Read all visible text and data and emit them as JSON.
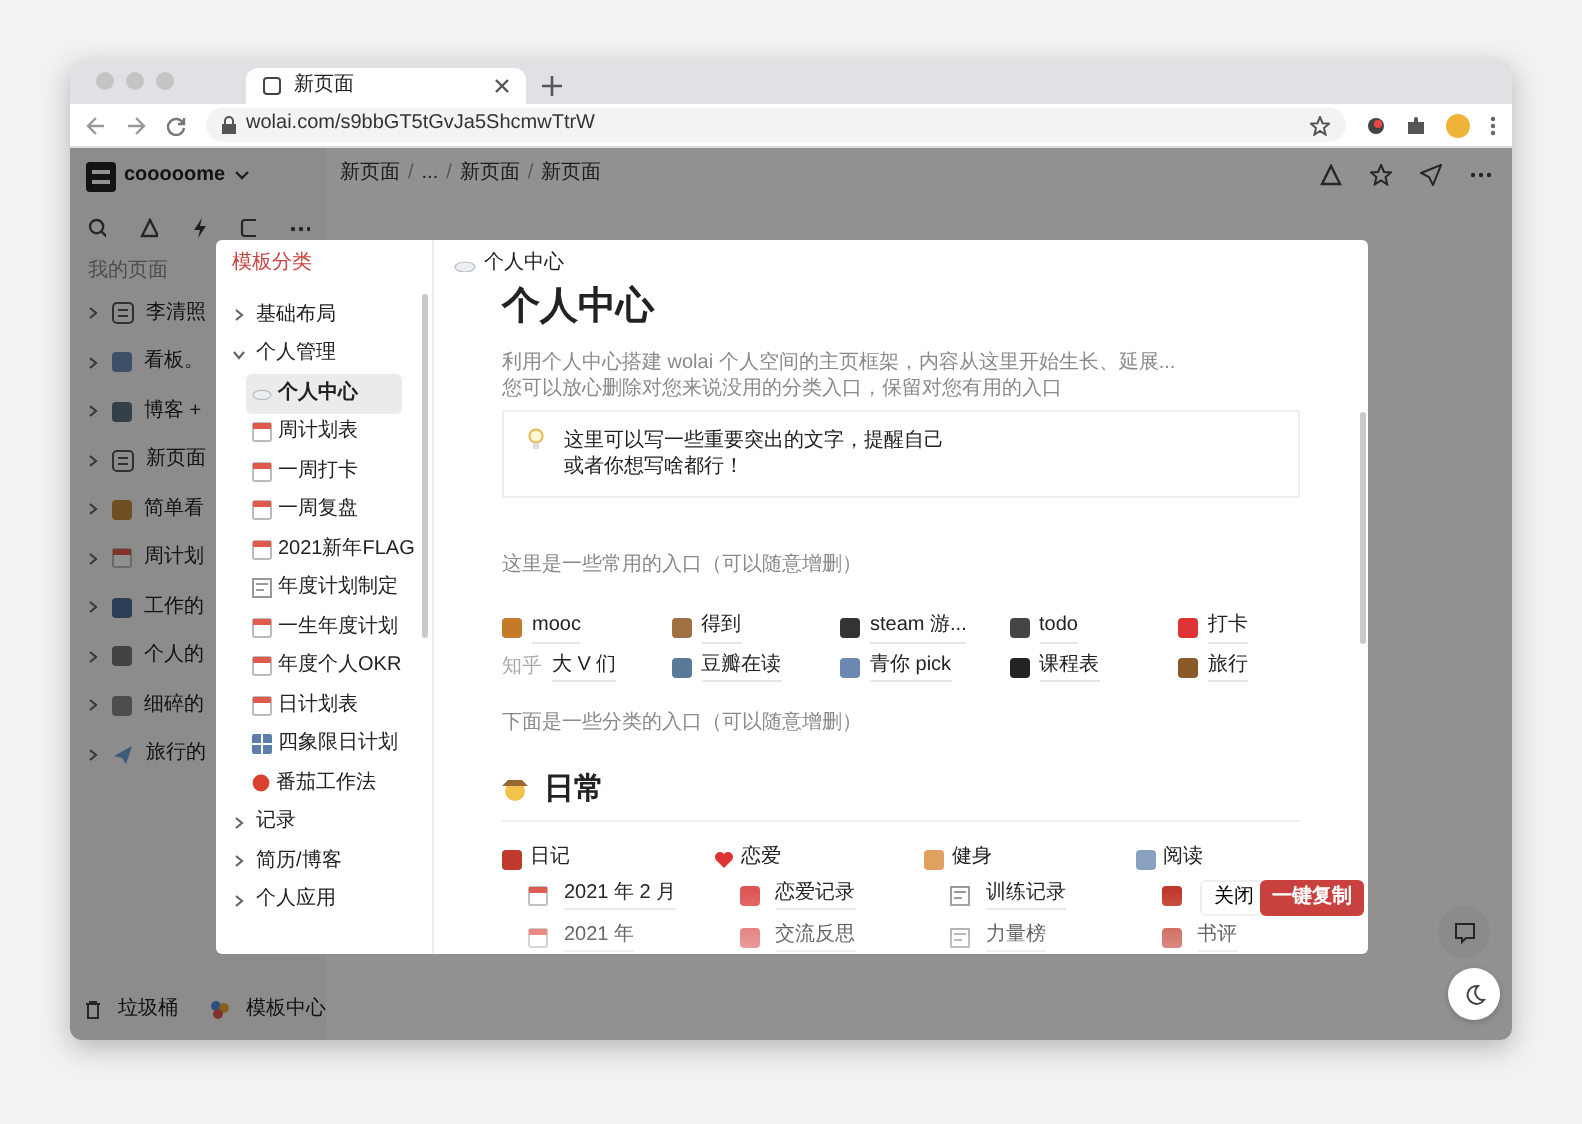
{
  "browser": {
    "tab_title": "新页面",
    "url": "wolai.com/s9bbGT5tGvJa5ShcmwTtrW"
  },
  "workspace": {
    "name": "cooooome"
  },
  "sidebar": {
    "section": "我的页面",
    "items": [
      "李清照",
      "看板。",
      "博客 +",
      "新页面",
      "简单看",
      "周计划",
      "工作的",
      "个人的",
      "细碎的",
      "旅行的"
    ],
    "footer": [
      "垃圾桶",
      "模板中心"
    ]
  },
  "breadcrumb": [
    {
      "kind": "item",
      "text": "新页面"
    },
    {
      "kind": "separator",
      "text": "/"
    },
    {
      "kind": "item",
      "text": "..."
    },
    {
      "kind": "separator",
      "text": "/"
    },
    {
      "kind": "item",
      "text": "新页面"
    },
    {
      "kind": "separator",
      "text": "/"
    },
    {
      "kind": "item",
      "text": "新页面"
    }
  ],
  "template_modal": {
    "title": "模板分类",
    "categories": [
      {
        "label": "基础布局",
        "expanded": false
      },
      {
        "label": "个人管理",
        "expanded": true,
        "children": [
          {
            "label": "个人中心",
            "selected": true
          },
          {
            "label": "周计划表",
            "selected": false
          },
          {
            "label": "一周打卡",
            "selected": false
          },
          {
            "label": "一周复盘",
            "selected": false
          },
          {
            "label": "2021新年FLAG",
            "selected": false
          },
          {
            "label": "年度计划制定",
            "selected": false
          },
          {
            "label": "一生年度计划",
            "selected": false
          },
          {
            "label": "年度个人OKR",
            "selected": false
          },
          {
            "label": "日计划表",
            "selected": false
          },
          {
            "label": "四象限日计划",
            "selected": false
          },
          {
            "label": "番茄工作法",
            "selected": false
          }
        ]
      },
      {
        "label": "记录",
        "expanded": false
      },
      {
        "label": "简历/博客",
        "expanded": false
      },
      {
        "label": "个人应用",
        "expanded": false
      }
    ]
  },
  "preview": {
    "breadcrumb": "个人中心",
    "title": "个人中心",
    "intro": [
      "利用个人中心搭建 wolai 个人空间的主页框架，内容从这里开始生长、延展...",
      "您可以放心删除对您来说没用的分类入口，保留对您有用的入口"
    ],
    "callout": [
      "这里可以写一些重要突出的文字，提醒自己",
      "或者你想写啥都行！"
    ],
    "common_label": "这里是一些常用的入口（可以随意增删）",
    "shortcuts": [
      {
        "label": "mooc"
      },
      {
        "label": "得到"
      },
      {
        "label": "steam 游..."
      },
      {
        "label": "todo"
      },
      {
        "label": "打卡"
      },
      {
        "logo_text": "知乎",
        "label": "大 V 们"
      },
      {
        "label": "豆瓣在读"
      },
      {
        "label": "青你 pick"
      },
      {
        "label": "课程表"
      },
      {
        "label": "旅行"
      }
    ],
    "category_label": "下面是一些分类的入口（可以随意增删）",
    "section_title": "日常",
    "columns": [
      {
        "title": "日记",
        "items": [
          {
            "label": "2021 年 2 月"
          },
          {
            "label": "2021 年"
          }
        ]
      },
      {
        "title": "恋爱",
        "items": [
          {
            "label": "恋爱记录"
          },
          {
            "label": "交流反思"
          }
        ]
      },
      {
        "title": "健身",
        "items": [
          {
            "label": "训练记录"
          },
          {
            "label": "力量榜"
          }
        ]
      },
      {
        "title": "阅读",
        "items": [
          {
            "kind": "covered"
          },
          {
            "kind": "link",
            "label": "书评"
          }
        ]
      }
    ]
  },
  "buttons": {
    "close": "关闭",
    "copy": "一键复制"
  }
}
